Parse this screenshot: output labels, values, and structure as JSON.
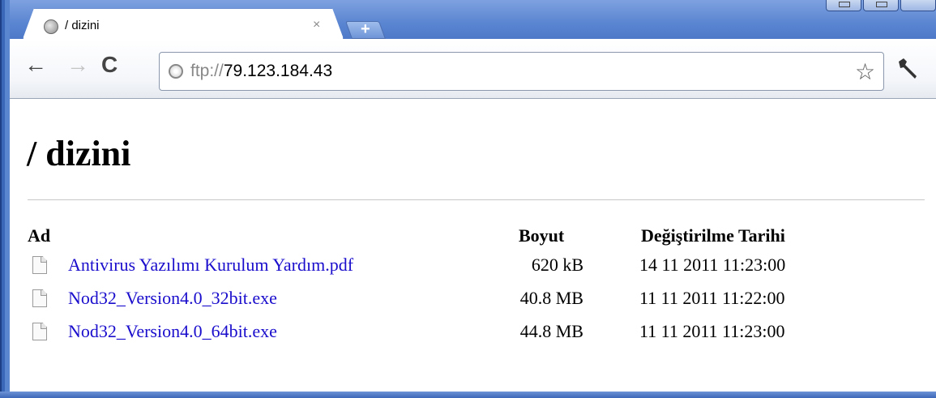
{
  "tab": {
    "title": "/ dizini",
    "close": "×",
    "new_tab": "+"
  },
  "toolbar": {
    "back": "←",
    "forward": "→",
    "reload": "C",
    "url_scheme": "ftp://",
    "url_host": "79.123.184.43",
    "star": "☆",
    "wrench": "🔧"
  },
  "page": {
    "title": "/ dizini",
    "columns": {
      "name": "Ad",
      "size": "Boyut",
      "date": "Değiştirilme Tarihi"
    },
    "files": [
      {
        "name": "Antivirus Yazılımı Kurulum Yardım.pdf",
        "size": "620 kB",
        "date": "14 11 2011 11:23:00"
      },
      {
        "name": "Nod32_Version4.0_32bit.exe",
        "size": "40.8 MB",
        "date": "11 11 2011 11:22:00"
      },
      {
        "name": "Nod32_Version4.0_64bit.exe",
        "size": "44.8 MB",
        "date": "11 11 2011 11:23:00"
      }
    ]
  },
  "colors": {
    "link": "#1a0dcc",
    "frame": "#4d79c8"
  }
}
